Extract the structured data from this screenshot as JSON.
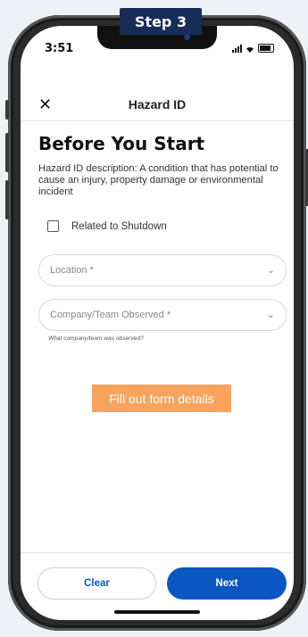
{
  "step_badge": "Step 3",
  "status_bar": {
    "time": "3:51"
  },
  "header": {
    "title": "Hazard ID",
    "close_icon": "close-icon"
  },
  "page": {
    "heading": "Before You Start",
    "description": "Hazard ID description: A condition that has potential to cause an injury, property damage or environmental incident",
    "related_to_shutdown": {
      "label": "Related to Shutdown",
      "checked": false
    },
    "location": {
      "placeholder": "Location *"
    },
    "company_team": {
      "placeholder": "Company/Team Observed *",
      "helper": "What company/team was observed?"
    }
  },
  "overlay_note": "Fill out form details",
  "footer": {
    "clear_label": "Clear",
    "next_label": "Next"
  },
  "colors": {
    "primary": "#0a56c2",
    "badge": "#172d57",
    "overlay": "#f7a35c"
  }
}
